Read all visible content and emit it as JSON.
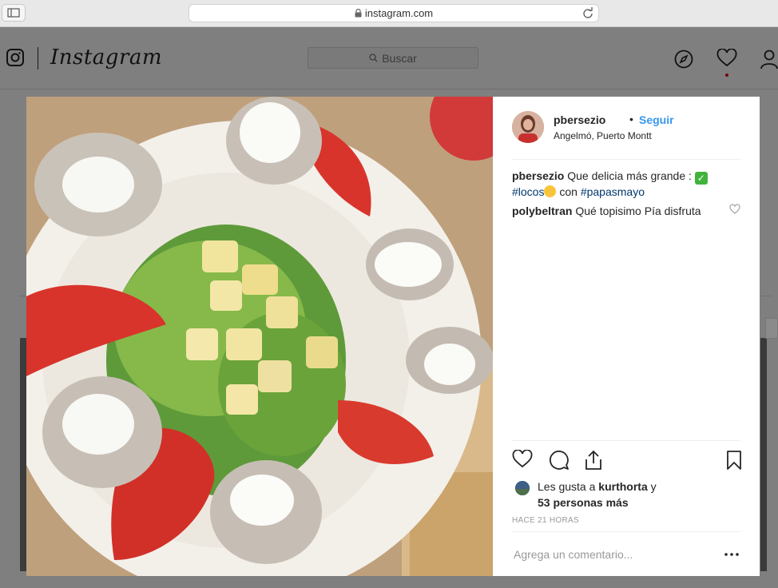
{
  "browser": {
    "url": "instagram.com"
  },
  "header": {
    "logo": "Instagram",
    "search_placeholder": "Buscar"
  },
  "post": {
    "author": "pbersezio",
    "follow_label": "Seguir",
    "separator": "•",
    "location": "Angelmó, Puerto Montt",
    "caption": {
      "author": "pbersezio",
      "text": "Que delicia más grande :",
      "tag1": "#locos",
      "middle": "con",
      "tag2": "#papasmayo"
    },
    "comments": [
      {
        "author": "polybeltran",
        "text": "Qué topisimo Pía disfruta"
      }
    ],
    "likes": {
      "prefix": "Les gusta a",
      "user": "kurthorta",
      "conj": "y",
      "others": "53 personas más"
    },
    "time": "HACE 21 HORAS",
    "comment_placeholder": "Agrega un comentario..."
  },
  "colors": {
    "accent": "#3897f0",
    "hashtag": "#00376b",
    "overlay": "#7f7f7f"
  }
}
